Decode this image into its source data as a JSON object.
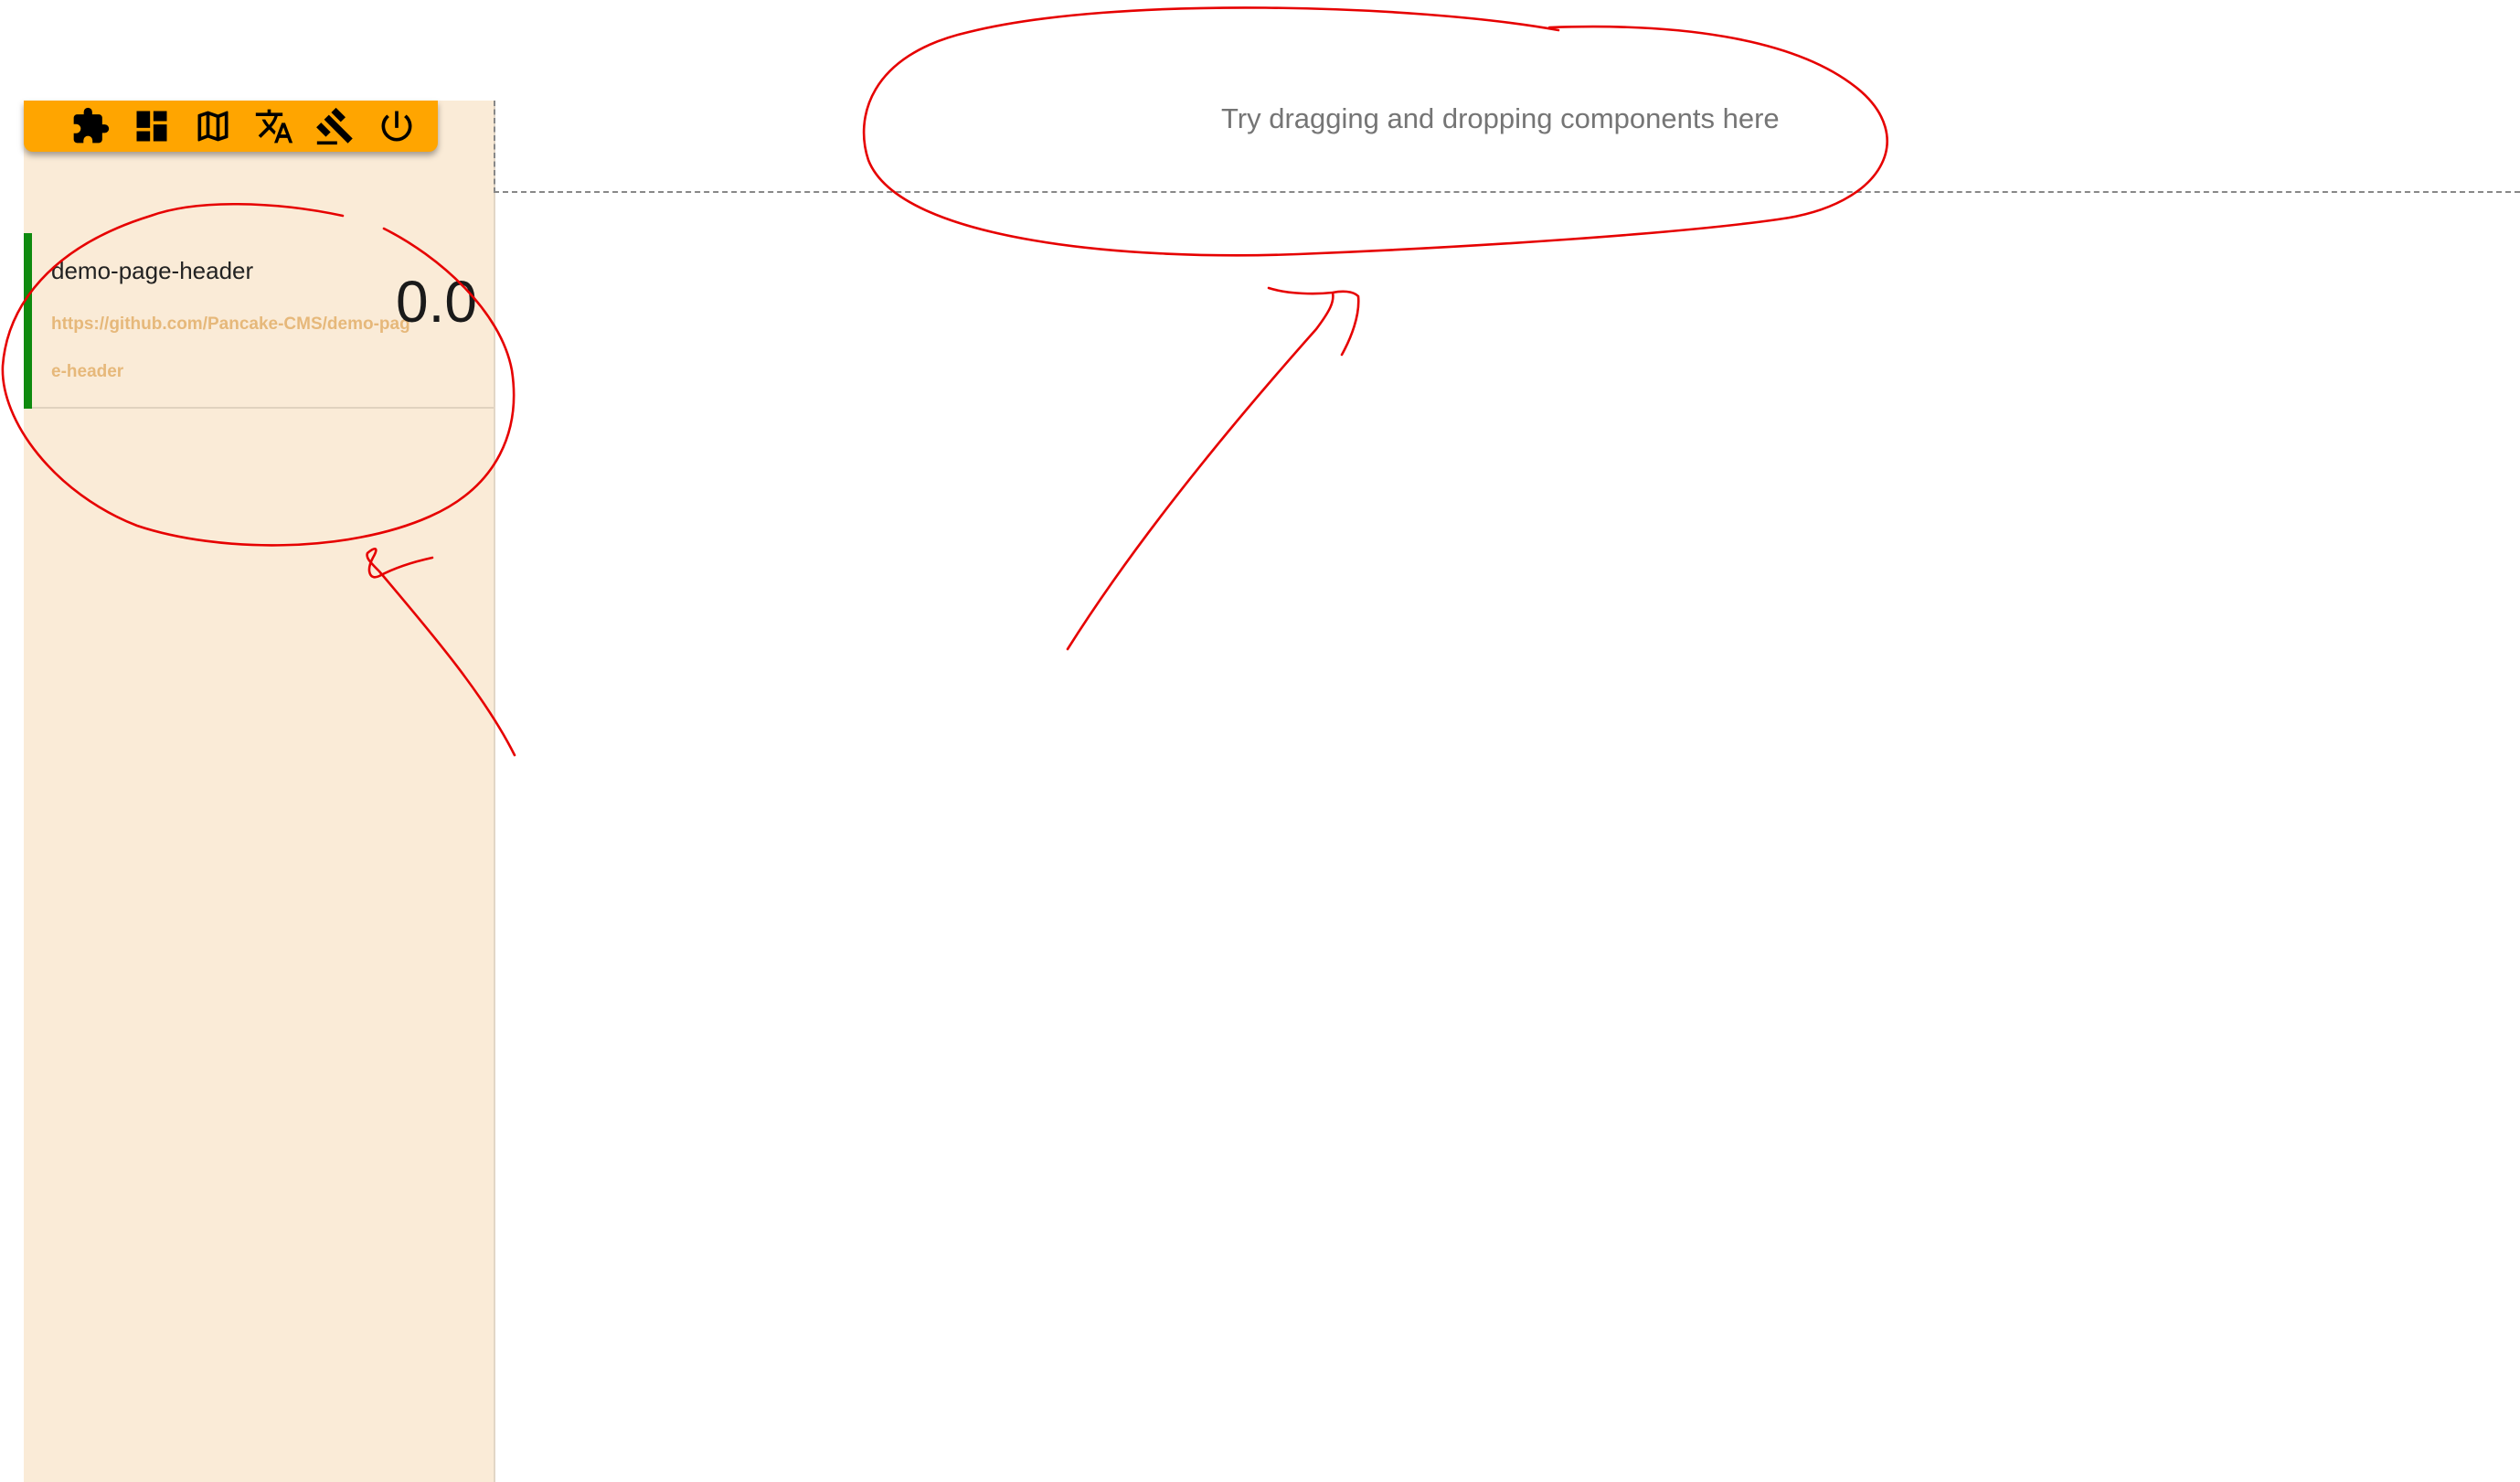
{
  "toolbar": {
    "background_color": "#ffa500",
    "icons": [
      "puzzle-icon",
      "dashboard-icon",
      "map-icon",
      "translate-icon",
      "gavel-icon",
      "power-icon"
    ]
  },
  "sidebar": {
    "background_color": "#faebd7",
    "components": [
      {
        "name": "demo-page-header",
        "url": "https://github.com/Pancake-CMS/demo-page-header",
        "version": "0.0",
        "status_color": "#0f8a0f"
      }
    ]
  },
  "dropzone": {
    "hint": "Try dragging and dropping components here"
  },
  "annotation_color": "#e60000"
}
